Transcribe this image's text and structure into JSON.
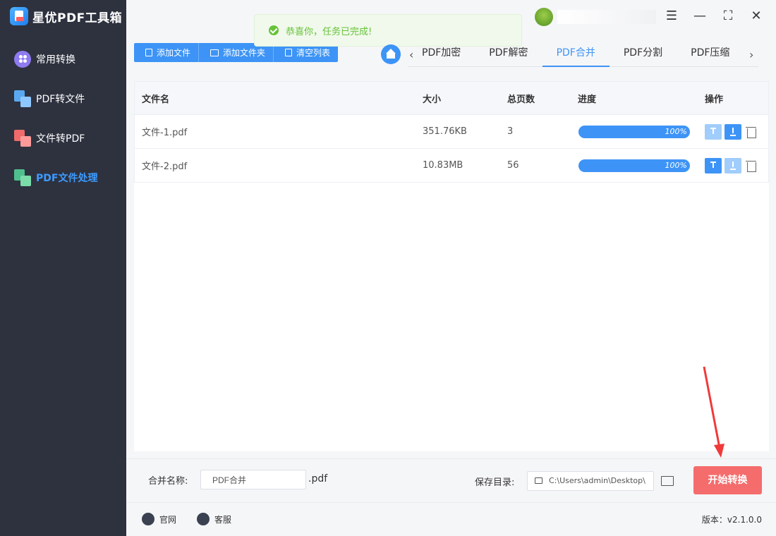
{
  "app": {
    "title": "星优PDF工具箱"
  },
  "sidebar": {
    "items": [
      {
        "label": "常用转换"
      },
      {
        "label": "PDF转文件"
      },
      {
        "label": "文件转PDF"
      },
      {
        "label": "PDF文件处理"
      }
    ]
  },
  "toast": {
    "message": "恭喜你，任务已完成!"
  },
  "toolbar": {
    "add_file": "添加文件",
    "add_folder": "添加文件夹",
    "clear_list": "清空列表"
  },
  "tabs": [
    {
      "label": "PDF加密"
    },
    {
      "label": "PDF解密"
    },
    {
      "label": "PDF合并"
    },
    {
      "label": "PDF分割"
    },
    {
      "label": "PDF压缩"
    }
  ],
  "table": {
    "headers": {
      "name": "文件名",
      "size": "大小",
      "pages": "总页数",
      "progress": "进度",
      "actions": "操作"
    },
    "rows": [
      {
        "name": "文件-1.pdf",
        "size": "351.76KB",
        "pages": "3",
        "progress": "100%"
      },
      {
        "name": "文件-2.pdf",
        "size": "10.83MB",
        "pages": "56",
        "progress": "100%"
      }
    ]
  },
  "bottom": {
    "merge_name_label": "合并名称:",
    "merge_name_value": "PDF合并",
    "ext": ".pdf",
    "save_dir_label": "保存目录:",
    "save_dir_value": "C:\\Users\\admin\\Desktop\\",
    "start_button": "开始转换"
  },
  "footer": {
    "website": "官网",
    "service": "客服",
    "version": "版本：v2.1.0.0"
  },
  "colors": {
    "accent": "#3d94f6",
    "sidebar": "#2e323f",
    "success": "#67c23a",
    "danger": "#f56c6c"
  }
}
